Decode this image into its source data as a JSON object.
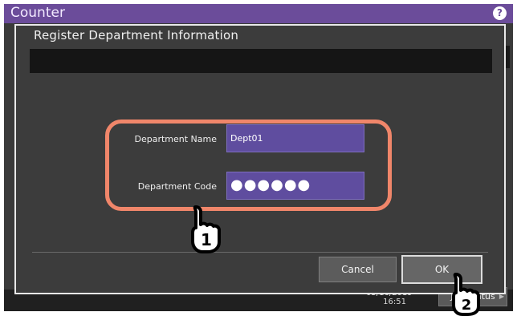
{
  "app": {
    "title": "Counter",
    "help_icon": "?"
  },
  "dialog": {
    "title": "Register Department Information",
    "fields": {
      "name": {
        "label": "Department Name",
        "value": "Dept01"
      },
      "code": {
        "label": "Department Code",
        "masked_value": "●●●●●●"
      }
    },
    "buttons": {
      "cancel": "Cancel",
      "ok": "OK"
    }
  },
  "statusbar": {
    "date": "05/16/2019",
    "time": "16:51",
    "job_status": "Job Status"
  },
  "callouts": {
    "step1": "1",
    "step2": "2"
  },
  "colors": {
    "titlebar": "#6b4c9a",
    "input_fill": "#5f4d9f",
    "highlight": "#f0866a",
    "dialog_bg": "#3c3c3c"
  },
  "icons": [
    "help-icon",
    "hand-pointer-icon"
  ]
}
